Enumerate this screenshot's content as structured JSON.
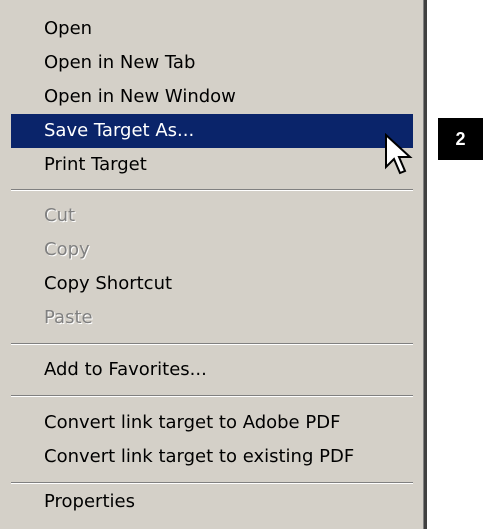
{
  "menu": {
    "items": [
      {
        "label": "Open",
        "state": "normal"
      },
      {
        "label": "Open in New Tab",
        "state": "normal"
      },
      {
        "label": "Open in New Window",
        "state": "normal"
      },
      {
        "label": "Save Target As...",
        "state": "highlighted"
      },
      {
        "label": "Print Target",
        "state": "normal"
      },
      {
        "label": "Cut",
        "state": "disabled"
      },
      {
        "label": "Copy",
        "state": "disabled"
      },
      {
        "label": "Copy Shortcut",
        "state": "normal"
      },
      {
        "label": "Paste",
        "state": "disabled"
      },
      {
        "label": "Add to Favorites...",
        "state": "normal"
      },
      {
        "label": "Convert link target to Adobe PDF",
        "state": "normal"
      },
      {
        "label": "Convert link target to existing PDF",
        "state": "normal"
      },
      {
        "label": "Properties",
        "state": "normal"
      }
    ]
  },
  "callout": {
    "number": "2"
  },
  "colors": {
    "menu_background": "#d4d0c8",
    "highlight": "#0a246a",
    "disabled_text": "#808080"
  },
  "icons": {
    "cursor": "arrow-cursor-icon"
  }
}
